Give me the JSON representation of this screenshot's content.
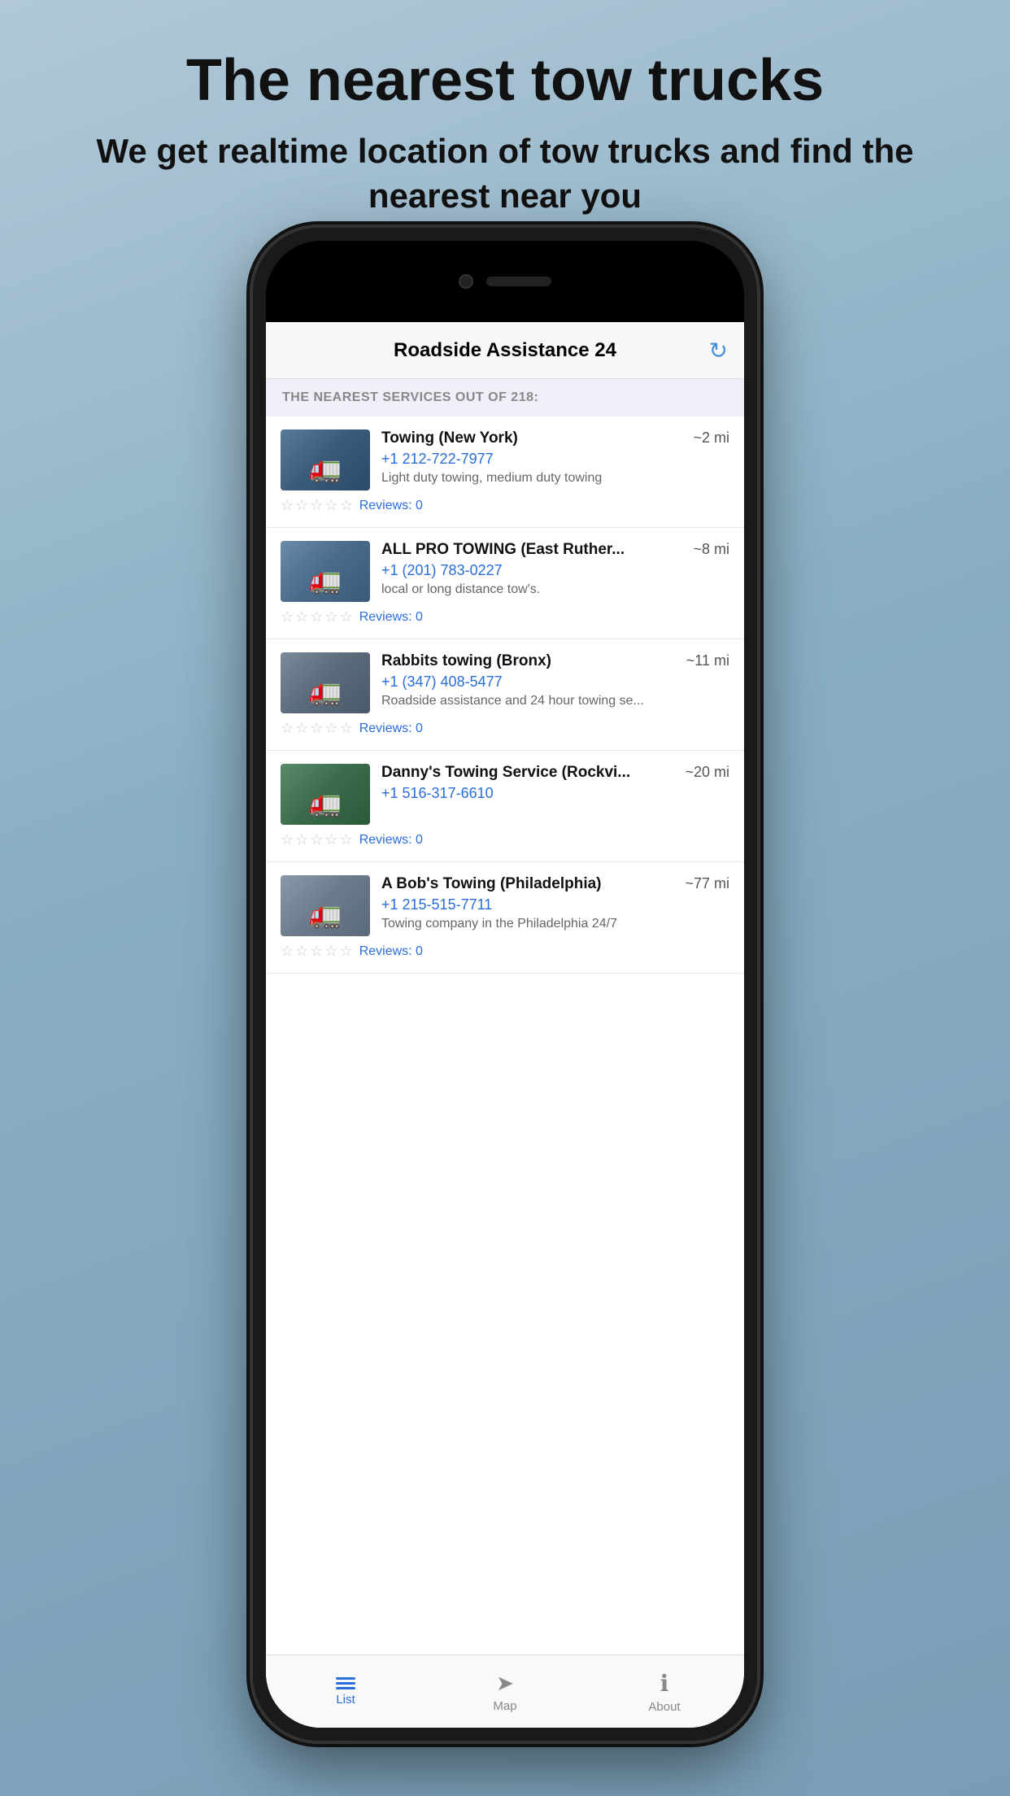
{
  "header": {
    "title": "The nearest tow trucks",
    "subtitle": "We get realtime location of tow trucks and find the nearest near you"
  },
  "app": {
    "title": "Roadside Assistance 24",
    "nearest_label": "THE NEAREST SERVICES OUT OF 218:",
    "refresh_icon": "↻"
  },
  "services": [
    {
      "id": 1,
      "name": "Towing (New York)",
      "distance": "~2 mi",
      "phone": "+1 212-722-7977",
      "description": "Light duty towing, medium duty towing",
      "reviews": "Reviews: 0",
      "img_class": "img-1"
    },
    {
      "id": 2,
      "name": "ALL PRO TOWING (East Ruther...",
      "distance": "~8 mi",
      "phone": "+1 (201) 783-0227",
      "description": "local or long distance tow's.",
      "reviews": "Reviews: 0",
      "img_class": "img-2"
    },
    {
      "id": 3,
      "name": "Rabbits towing (Bronx)",
      "distance": "~11 mi",
      "phone": "+1 (347) 408-5477",
      "description": "Roadside assistance and 24 hour towing se...",
      "reviews": "Reviews: 0",
      "img_class": "img-3"
    },
    {
      "id": 4,
      "name": "Danny's Towing Service (Rockvi...",
      "distance": "~20 mi",
      "phone": "+1 516-317-6610",
      "description": "",
      "reviews": "Reviews: 0",
      "img_class": "img-4"
    },
    {
      "id": 5,
      "name": "A Bob's Towing (Philadelphia)",
      "distance": "~77 mi",
      "phone": "+1 215-515-7711",
      "description": "Towing company in the Philadelphia 24/7",
      "reviews": "Reviews: 0",
      "img_class": "img-5"
    }
  ],
  "tabs": [
    {
      "id": "list",
      "label": "List",
      "active": true
    },
    {
      "id": "map",
      "label": "Map",
      "active": false
    },
    {
      "id": "about",
      "label": "About",
      "active": false
    }
  ]
}
